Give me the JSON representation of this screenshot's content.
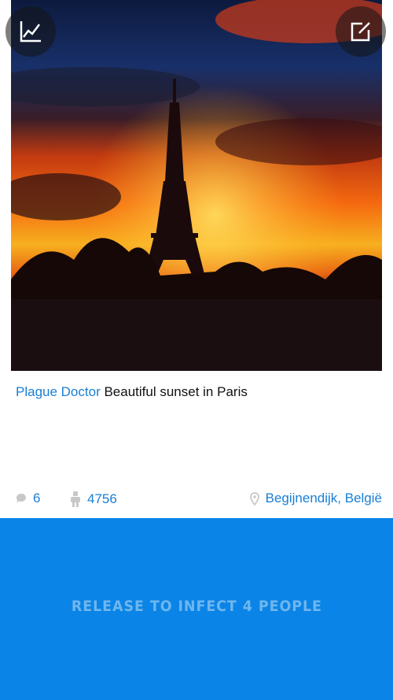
{
  "post": {
    "author": "Plague Doctor",
    "caption": "Beautiful sunset in Paris"
  },
  "stats": {
    "comments": "6",
    "infected": "4756",
    "location": "Begijnendijk, België"
  },
  "action": {
    "release_label": "RELEASE TO INFECT 4 PEOPLE"
  },
  "icons": {
    "stats": "chart-line-icon",
    "edit": "edit-icon",
    "comment": "comment-icon",
    "infected": "person-icon",
    "location": "location-pin-icon"
  },
  "colors": {
    "accent": "#1a7fd6",
    "panel": "#0a84e6",
    "panel_text": "#6fb6ee"
  }
}
